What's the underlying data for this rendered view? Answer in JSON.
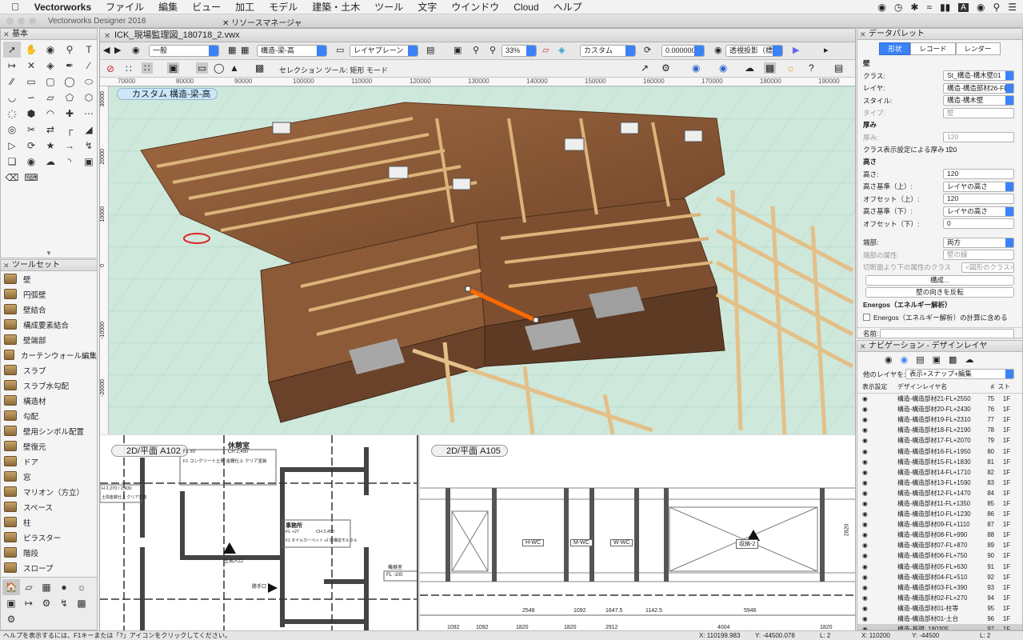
{
  "menubar": {
    "app": "Vectorworks",
    "items": [
      "ファイル",
      "編集",
      "ビュー",
      "加工",
      "モデル",
      "建築・土木",
      "ツール",
      "文字",
      "ウインドウ",
      "Cloud",
      "ヘルプ"
    ]
  },
  "app_window_title": "Vectorworks Designer 2018",
  "resource_manager": "リソースマネージャ",
  "palettes": {
    "basic": "基本",
    "toolset": "ツールセット",
    "toolset_items": [
      "壁",
      "円弧壁",
      "壁結合",
      "構成要素結合",
      "壁端部",
      "カーテンウォール編集",
      "スラブ",
      "スラブ水勾配",
      "構造材",
      "勾配",
      "壁用シンボル配置",
      "壁復元",
      "ドア",
      "窓",
      "マリオン（方立）",
      "スペース",
      "柱",
      "ピラスター",
      "階段",
      "スロープ"
    ]
  },
  "document": {
    "title": "ICK_現場監理図_180718_2.vwx",
    "class_select": "一般",
    "layer_select": "構造-梁-高",
    "plane_select": "レイヤプレーン",
    "zoom": "33%",
    "view_select": "カスタム",
    "angle": "0.00000000°",
    "projection": "透視投影（標準）",
    "mode_text": "セレクション ツール: 矩形 モード",
    "ruler_marks": [
      "70000",
      "80000",
      "90000",
      "100000",
      "110000",
      "120000",
      "130000",
      "140000",
      "150000",
      "160000",
      "170000",
      "180000",
      "190000"
    ],
    "vruler_marks": [
      "30000",
      "20000",
      "10000",
      "0",
      "-10000",
      "-20000"
    ]
  },
  "viewports": {
    "main": "カスタム  構造-梁-高",
    "plan_a102": "2D/平面  A102",
    "plan_a105": "2D/平面  A105"
  },
  "plan_a102": {
    "room1": "休憩室",
    "room1_fl": "FL   ±0",
    "room1_ch": "CH 2,450",
    "room1_fin": "F1  コンクリート土間 金鏝仕上 クリア塗装",
    "room2": "事務所",
    "room2_fl": "FL   +27",
    "room2_ch": "CH 2,450",
    "room2_fin": "F1  タイルカーペット ㎡ 床構造モルタル",
    "entrance": "主出入口",
    "side_door": "勝手口",
    "machine": "機器室",
    "machine_fl": "FL -100",
    "left_dim": "H 2,270 / 2,430",
    "left_fin": "土間金鏝仕上 クリア塗装"
  },
  "plan_a105": {
    "rooms": [
      "H-WC",
      "M-WC",
      "W-WC",
      "収納-2"
    ],
    "height_dim": "2820",
    "dims_row1": [
      "2548",
      "1092",
      "1647.5",
      "1142.5",
      "5946"
    ],
    "dims_row2": [
      "1092",
      "1092",
      "1820",
      "1820",
      "2912",
      "4004",
      "1820"
    ]
  },
  "data_palette": {
    "title": "データパレット",
    "tabs": [
      "形状",
      "レコード",
      "レンダー"
    ],
    "object_type": "壁",
    "rows": {
      "class_label": "クラス:",
      "class_value": "St_構造-構木壁01",
      "layer_label": "レイヤ:",
      "layer_value": "構造-構造部材26-FL+3150-梁5",
      "style_label": "スタイル:",
      "style_value": "構造-構木壁",
      "type_label": "タイプ:",
      "type_value": "壁",
      "thickness_section": "厚み",
      "thickness_label": "厚み:",
      "thickness_value": "120",
      "class_thick_label": "クラス表示設定による厚み（...",
      "class_thick_value": "120",
      "height_section": "高さ",
      "height_label": "高さ:",
      "height_value": "120",
      "top_label": "高さ基準（上）:",
      "top_value": "レイヤの高さ",
      "offset_top_label": "オフセット（上）:",
      "offset_top_value": "120",
      "bottom_label": "高さ基準（下）:",
      "bottom_value": "レイヤの高さ",
      "offset_bottom_label": "オフセット（下）:",
      "offset_bottom_value": "0",
      "end_label": "端部:",
      "end_value": "両方",
      "end_attr_label": "端部の属性:",
      "end_attr_value": "壁の線",
      "cut_label": "切断面より下の属性のクラス",
      "cut_value": "<図形のクラス>",
      "config_button": "構成...",
      "flip_button": "壁の向きを反転",
      "energos_section": "Energos（エネルギー解析）",
      "energos_check": "Energos（エネルギー解析）の計算に含める",
      "name_label": "名前:"
    }
  },
  "navigation": {
    "title": "ナビゲーション - デザインレイヤ",
    "other_layers_label": "他のレイヤを:",
    "other_layers_value": "表示+スナップ+編集",
    "columns": [
      "表示設定",
      "デザインレイヤ名",
      "#",
      "スト"
    ],
    "rows": [
      {
        "name": "構造-構造部材21-FL+2550",
        "num": "75",
        "st": "1F"
      },
      {
        "name": "構造-構造部材20-FL+2430",
        "num": "76",
        "st": "1F"
      },
      {
        "name": "構造-構造部材19-FL+2310",
        "num": "77",
        "st": "1F"
      },
      {
        "name": "構造-構造部材18-FL+2190",
        "num": "78",
        "st": "1F"
      },
      {
        "name": "構造-構造部材17-FL+2070",
        "num": "79",
        "st": "1F"
      },
      {
        "name": "構造-構造部材16-FL+1950",
        "num": "80",
        "st": "1F"
      },
      {
        "name": "構造-構造部材15-FL+1830",
        "num": "81",
        "st": "1F"
      },
      {
        "name": "構造-構造部材14-FL+1710",
        "num": "82",
        "st": "1F"
      },
      {
        "name": "構造-構造部材13-FL+1590",
        "num": "83",
        "st": "1F"
      },
      {
        "name": "構造-構造部材12-FL+1470",
        "num": "84",
        "st": "1F"
      },
      {
        "name": "構造-構造部材11-FL+1350",
        "num": "85",
        "st": "1F"
      },
      {
        "name": "構造-構造部材10-FL+1230",
        "num": "86",
        "st": "1F"
      },
      {
        "name": "構造-構造部材09-FL+1110",
        "num": "87",
        "st": "1F"
      },
      {
        "name": "構造-構造部材08-FL+990",
        "num": "88",
        "st": "1F"
      },
      {
        "name": "構造-構造部材07-FL+870",
        "num": "89",
        "st": "1F"
      },
      {
        "name": "構造-構造部材06-FL+750",
        "num": "90",
        "st": "1F"
      },
      {
        "name": "構造-構造部材05-FL+630",
        "num": "91",
        "st": "1F"
      },
      {
        "name": "構造-構造部材04-FL+510",
        "num": "92",
        "st": "1F"
      },
      {
        "name": "構造-構造部材03-FL+390",
        "num": "93",
        "st": "1F"
      },
      {
        "name": "構造-構造部材02-FL+270",
        "num": "94",
        "st": "1F"
      },
      {
        "name": "構造-構造部材01-柱等",
        "num": "95",
        "st": "1F"
      },
      {
        "name": "構造-構造部材01-土台",
        "num": "96",
        "st": "1F"
      },
      {
        "name": "構造-基礎_180305",
        "num": "97",
        "st": "1F"
      },
      {
        "name": "***同時進行作業用",
        "num": "98",
        "st": ""
      }
    ]
  },
  "statusbar": {
    "help": "ヘルプを表示するには、F1キーまたは「?」アイコンをクリックしてください。",
    "x1": "X: 110199.983",
    "y1": "Y: -44500.078",
    "l1": "L: 2",
    "x2": "X: 110200",
    "y2": "Y: -44500",
    "l2": "L: 2"
  },
  "colors": {
    "accent": "#3b82f6",
    "wood": "#8b5e3c",
    "viewport_bg": "#cfe8dc"
  }
}
